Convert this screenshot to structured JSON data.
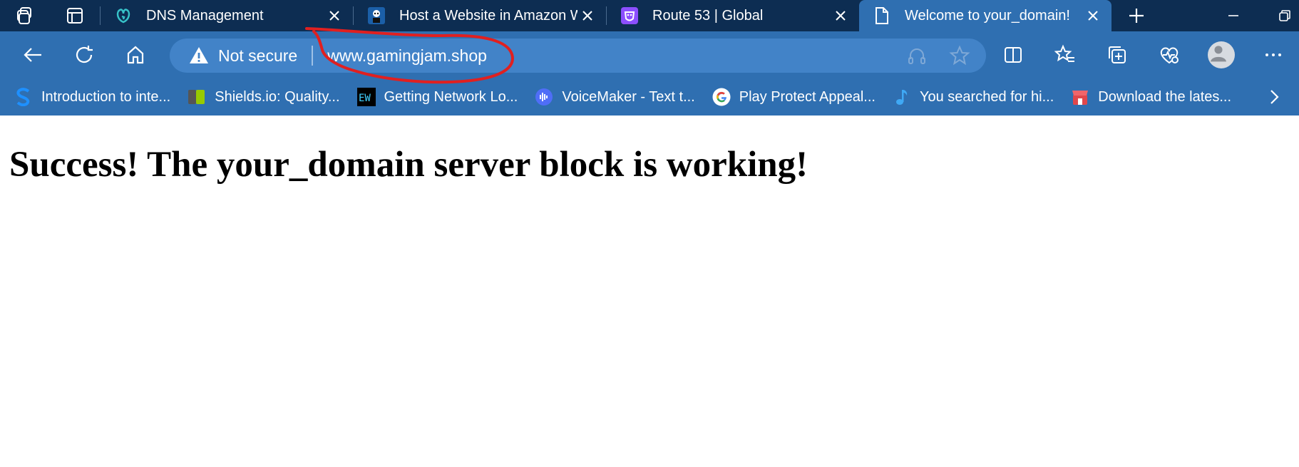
{
  "tabs": [
    {
      "title": "DNS Management",
      "icon": "godaddy-icon",
      "active": false
    },
    {
      "title": "Host a Website in Amazon W",
      "icon": "robot-avatar-icon",
      "active": false
    },
    {
      "title": "Route 53 | Global",
      "icon": "route53-icon",
      "active": false
    },
    {
      "title": "Welcome to your_domain!",
      "icon": "page-icon",
      "active": true
    }
  ],
  "omnibox": {
    "security_label": "Not secure",
    "url": "www.gamingjam.shop"
  },
  "bookmarks": [
    {
      "label": "Introduction to inte...",
      "icon": "s-logo-icon"
    },
    {
      "label": "Shields.io: Quality...",
      "icon": "shields-icon"
    },
    {
      "label": "Getting Network Lo...",
      "icon": "ew-icon"
    },
    {
      "label": "VoiceMaker - Text t...",
      "icon": "voicemaker-icon"
    },
    {
      "label": "Play Protect Appeal...",
      "icon": "google-icon"
    },
    {
      "label": "You searched for hi...",
      "icon": "music-note-icon"
    },
    {
      "label": "Download the lates...",
      "icon": "store-icon"
    }
  ],
  "page": {
    "heading": "Success! The your_domain server block is working!"
  },
  "colors": {
    "tabstrip_bg": "#0d2d52",
    "toolbar_bg": "#2f6fb1",
    "omnibox_bg": "#4283c8",
    "annotation": "#e02020"
  }
}
